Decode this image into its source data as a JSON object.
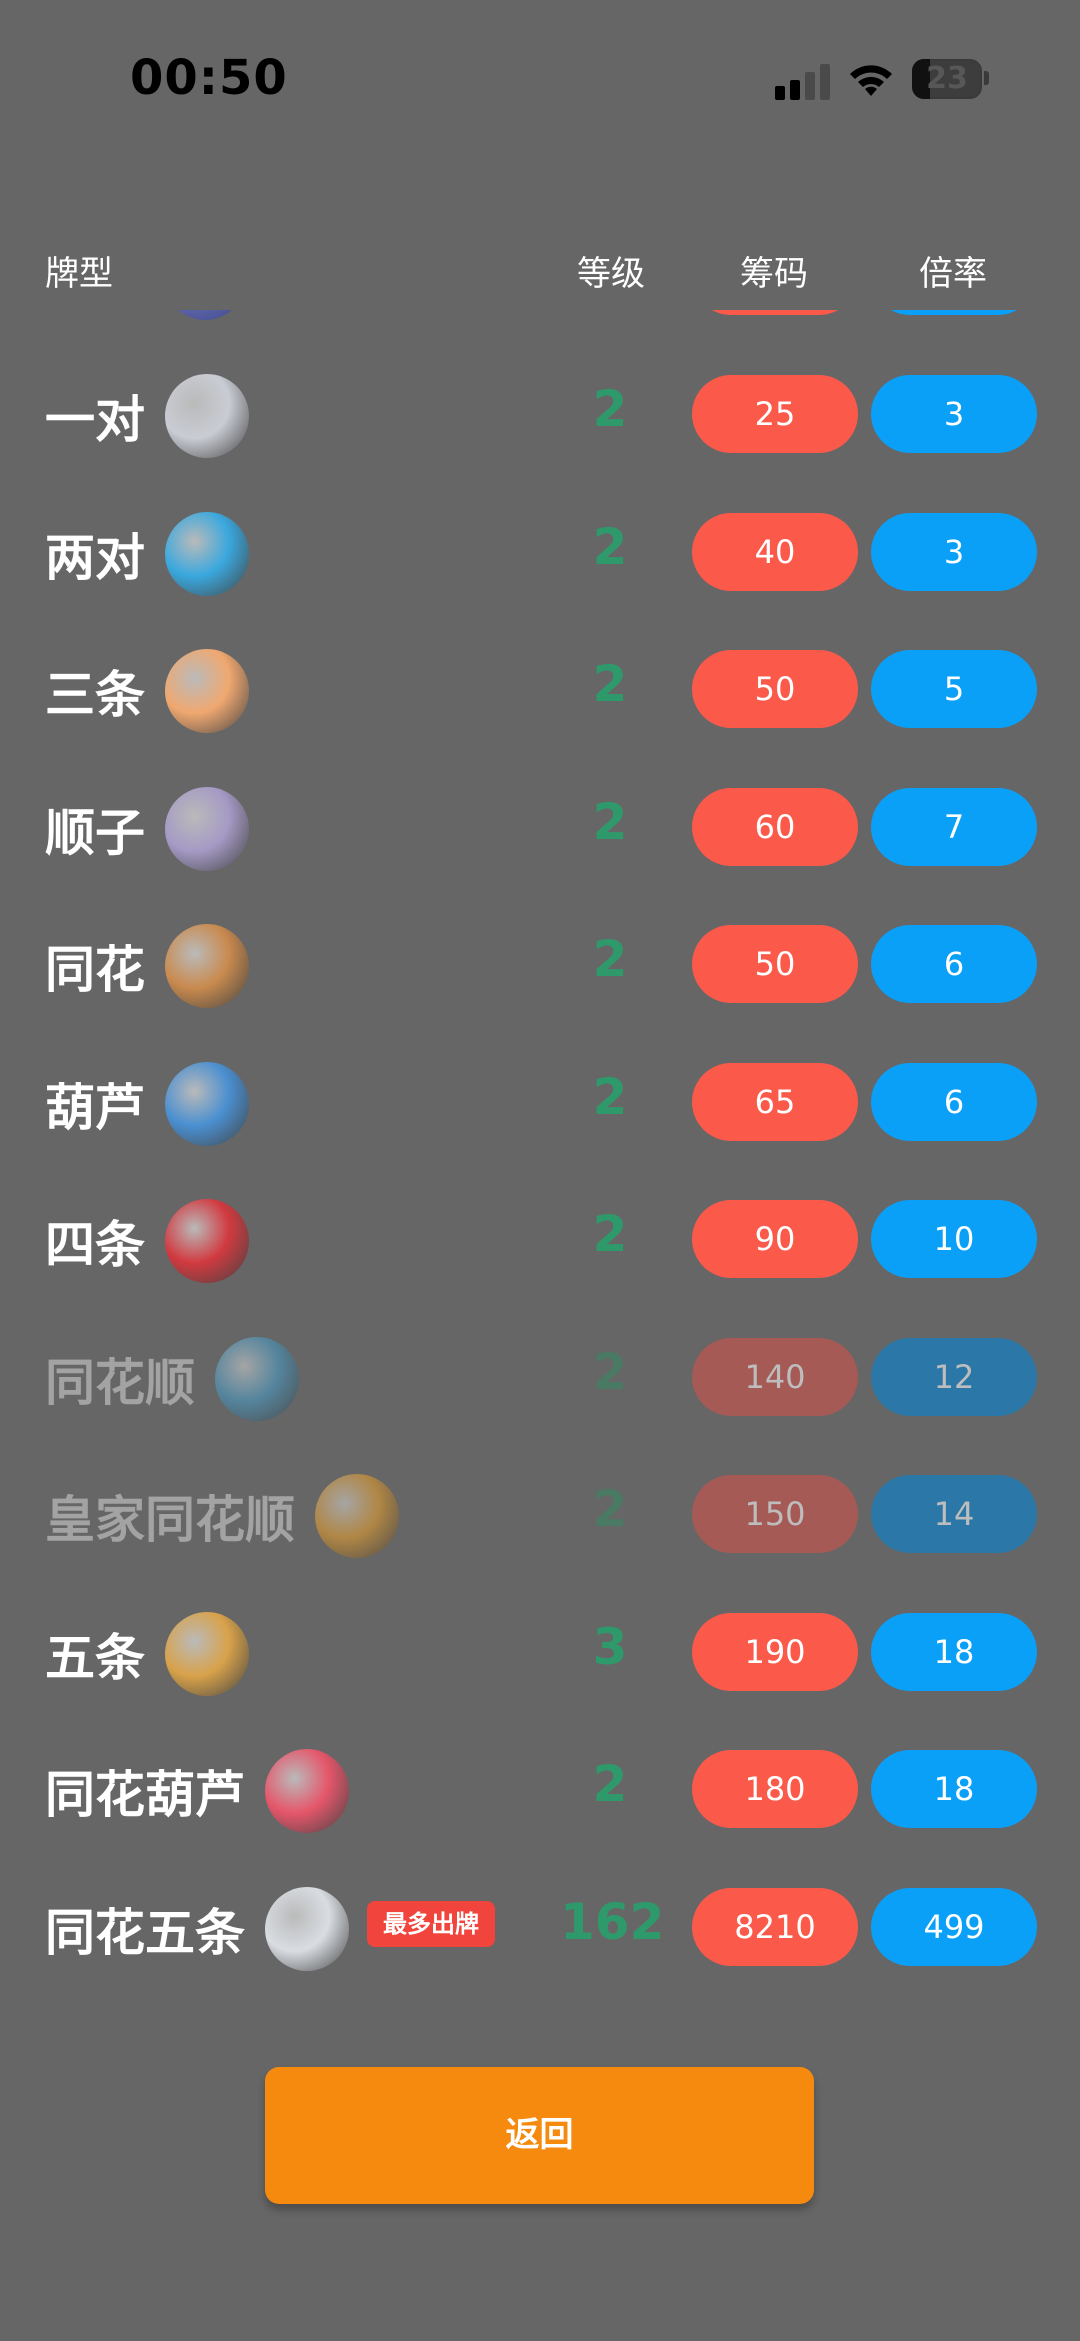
{
  "status_bar": {
    "time": "00:50",
    "battery": "23"
  },
  "header": {
    "type": "牌型",
    "level": "等级",
    "chips": "筹码",
    "mult": "倍率"
  },
  "rows": [
    {
      "name": "一对",
      "level": "2",
      "chips": "25",
      "mult": "3",
      "dim": false,
      "planet_color": "#c9ccd3"
    },
    {
      "name": "两对",
      "level": "2",
      "chips": "40",
      "mult": "3",
      "dim": false,
      "planet_color": "#3aa8de"
    },
    {
      "name": "三条",
      "level": "2",
      "chips": "50",
      "mult": "5",
      "dim": false,
      "planet_color": "#f0a870"
    },
    {
      "name": "顺子",
      "level": "2",
      "chips": "60",
      "mult": "7",
      "dim": false,
      "planet_color": "#a59ac5"
    },
    {
      "name": "同花",
      "level": "2",
      "chips": "50",
      "mult": "6",
      "dim": false,
      "planet_color": "#c98a4e"
    },
    {
      "name": "葫芦",
      "level": "2",
      "chips": "65",
      "mult": "6",
      "dim": false,
      "planet_color": "#4a8fd0"
    },
    {
      "name": "四条",
      "level": "2",
      "chips": "90",
      "mult": "10",
      "dim": false,
      "planet_color": "#d13a40"
    },
    {
      "name": "同花顺",
      "level": "2",
      "chips": "140",
      "mult": "12",
      "dim": true,
      "planet_color": "#4f8fb0"
    },
    {
      "name": "皇家同花顺",
      "level": "2",
      "chips": "150",
      "mult": "14",
      "dim": true,
      "planet_color": "#c9913a"
    },
    {
      "name": "五条",
      "level": "3",
      "chips": "190",
      "mult": "18",
      "dim": false,
      "planet_color": "#d8a24a"
    },
    {
      "name": "同花葫芦",
      "level": "2",
      "chips": "180",
      "mult": "18",
      "dim": false,
      "planet_color": "#e5566a"
    },
    {
      "name": "同花五条",
      "level": "162",
      "chips": "8210",
      "mult": "499",
      "dim": false,
      "planet_color": "#d9dde2",
      "badge": "最多出牌"
    }
  ],
  "back_button": {
    "label": "返回"
  }
}
